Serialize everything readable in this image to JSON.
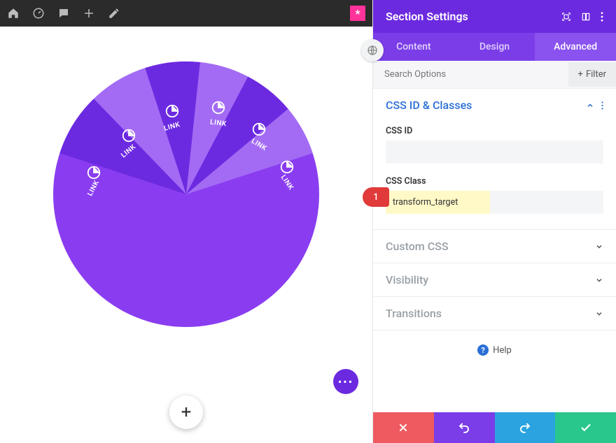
{
  "topbar": {
    "star": "*"
  },
  "pie": {
    "slice_label": "LINK",
    "colors": {
      "base": "#8a3df0",
      "dark": "#6c2ae0",
      "light": "#a36bf4"
    }
  },
  "marker": {
    "num": "1"
  },
  "panel": {
    "title": "Section Settings",
    "tabs": [
      "Content",
      "Design",
      "Advanced"
    ],
    "active_tab": 2,
    "search_placeholder": "Search Options",
    "filter_label": "Filter",
    "groups": {
      "css_id_classes": {
        "title": "CSS ID & Classes",
        "css_id_label": "CSS ID",
        "css_id_value": "",
        "css_class_label": "CSS Class",
        "css_class_value": "transform_target"
      },
      "custom_css": {
        "title": "Custom CSS"
      },
      "visibility": {
        "title": "Visibility"
      },
      "transitions": {
        "title": "Transitions"
      }
    },
    "help_label": "Help"
  }
}
